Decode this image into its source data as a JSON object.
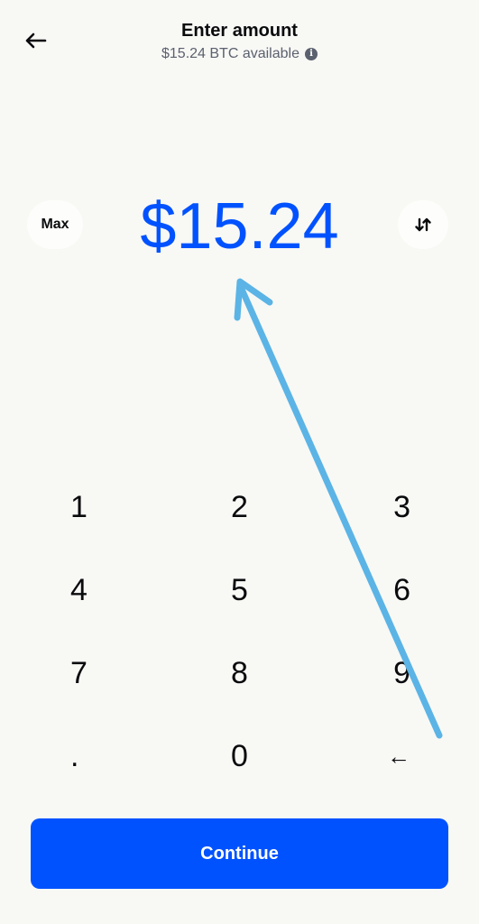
{
  "header": {
    "title": "Enter amount",
    "subtitle": "$15.24 BTC available",
    "info_icon": "info-icon",
    "back_icon": "arrow-left-icon"
  },
  "amount": {
    "max_label": "Max",
    "value": "$15.24",
    "swap_icon": "swap-vertical-icon"
  },
  "keypad": {
    "keys": [
      "1",
      "2",
      "3",
      "4",
      "5",
      "6",
      "7",
      "8",
      "9",
      ".",
      "0",
      "←"
    ]
  },
  "continue_label": "Continue",
  "colors": {
    "accent": "#0052ff",
    "background": "#f8f8f5",
    "annotation_arrow": "#5bb4e5"
  }
}
